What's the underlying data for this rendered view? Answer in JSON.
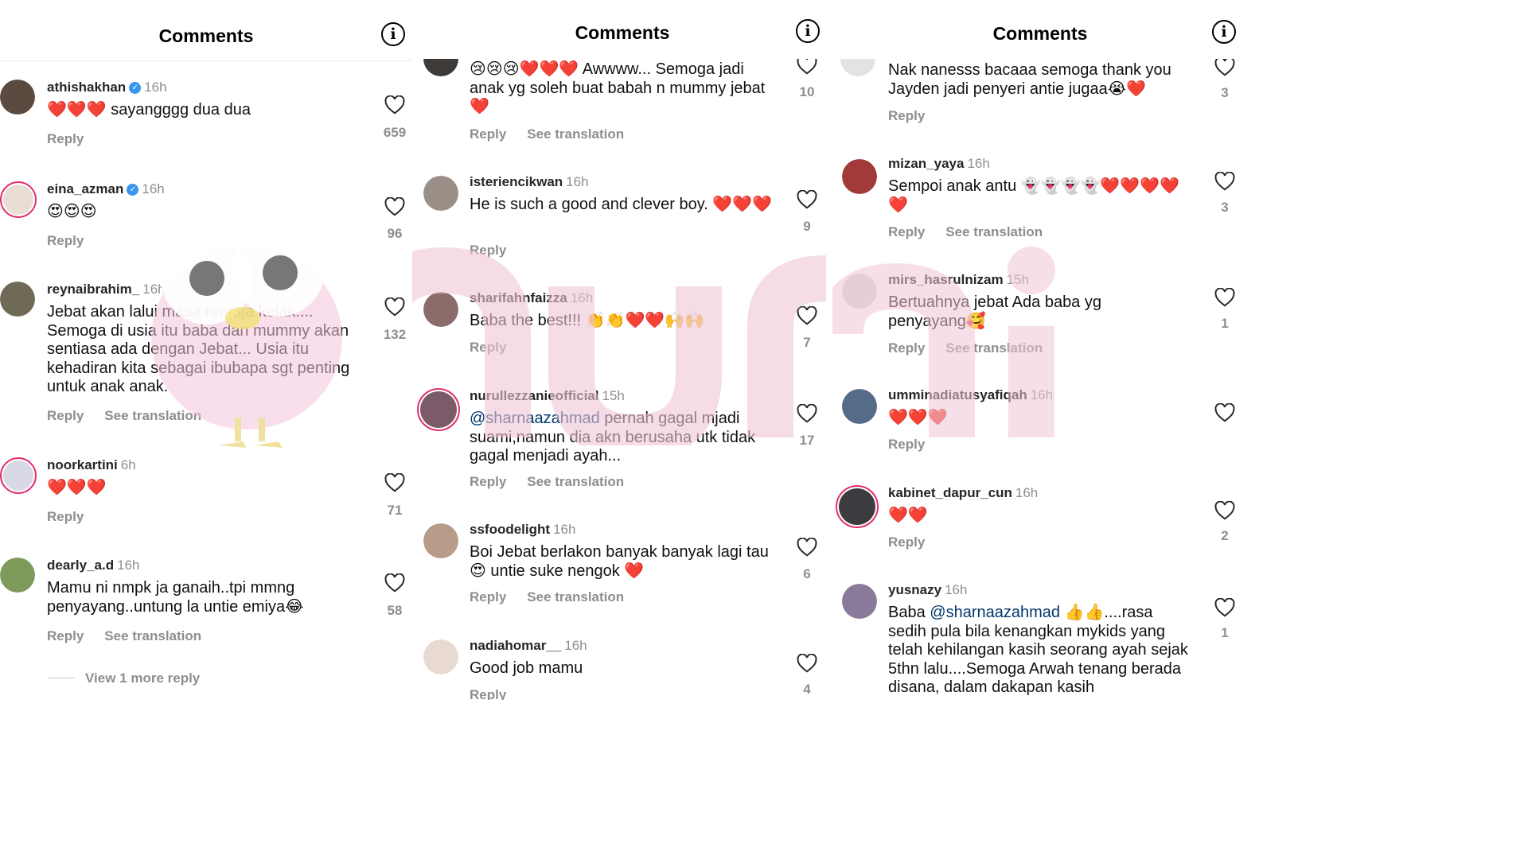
{
  "panels": [
    {
      "title": "Comments",
      "comments": [
        {
          "user": "athishakhan",
          "verified": true,
          "time": "16h",
          "text": "❤️❤️❤️ sayangggg dua dua",
          "actions": [
            "Reply"
          ],
          "likes": "659"
        },
        {
          "user": "eina_azman",
          "verified": true,
          "time": "16h",
          "text": "😍😍😍",
          "actions": [
            "Reply"
          ],
          "likes": "96"
        },
        {
          "user": "reynaibrahim_",
          "verified": false,
          "time": "16h",
          "text": "Jebat akan lalui masa remaja kelak.... Semoga di usia itu baba dan mummy akan sentiasa ada dengan Jebat... Usia itu kehadiran kita sebagai ibubapa sgt penting untuk anak anak.",
          "actions": [
            "Reply",
            "See translation"
          ],
          "likes": "132"
        },
        {
          "user": "noorkartini",
          "verified": false,
          "time": "6h",
          "text": "❤️❤️❤️",
          "actions": [
            "Reply"
          ],
          "likes": "71"
        },
        {
          "user": "dearly_a.d",
          "verified": false,
          "time": "16h",
          "text": "Mamu ni nmpk ja ganaih..tpi mmng penyayang..untung la untie emiya😂",
          "actions": [
            "Reply",
            "See translation"
          ],
          "likes": "58"
        }
      ],
      "more_replies": "View 1 more reply"
    },
    {
      "title": "Comments",
      "comments": [
        {
          "user": "",
          "verified": false,
          "time": "",
          "text": "😢😢😢❤️❤️❤️ Awwww... Semoga jadi anak yg soleh buat babah n mummy jebat❤️",
          "actions": [
            "Reply",
            "See translation"
          ],
          "likes": "10"
        },
        {
          "user": "isteriencikwan",
          "verified": false,
          "time": "16h",
          "text": "He is such a good and clever boy. ❤️❤️❤️",
          "actions": [
            "Reply"
          ],
          "likes": "9"
        },
        {
          "user": "sharifahnfaizza",
          "verified": false,
          "time": "16h",
          "text": "Baba the best!!! 👏👏❤️❤️🙌🙌",
          "actions": [
            "Reply"
          ],
          "likes": "7"
        },
        {
          "user": "nurullezzanieofficial",
          "verified": false,
          "time": "15h",
          "mention": "@sharnaazahmad",
          "text": " pernah gagal mjadi suami,namun dia akn berusaha utk tidak gagal menjadi ayah...",
          "actions": [
            "Reply",
            "See translation"
          ],
          "likes": "17"
        },
        {
          "user": "ssfoodelight",
          "verified": false,
          "time": "16h",
          "text": "Boi Jebat berlakon banyak banyak lagi tau 😍 untie suke nengok ❤️",
          "actions": [
            "Reply",
            "See translation"
          ],
          "likes": "6"
        },
        {
          "user": "nadiahomar__",
          "verified": false,
          "time": "16h",
          "text": "Good job mamu",
          "actions": [
            "Reply"
          ],
          "likes": "4"
        }
      ]
    },
    {
      "title": "Comments",
      "comments": [
        {
          "user": "",
          "verified": false,
          "time": "",
          "text": "Nak nanesss bacaaa semoga thank you Jayden jadi penyeri antie jugaa😭❤️",
          "actions": [
            "Reply"
          ],
          "likes": "3"
        },
        {
          "user": "mizan_yaya",
          "verified": false,
          "time": "16h",
          "text": "Sempoi anak antu 👻👻👻👻❤️❤️❤️❤️❤️",
          "actions": [
            "Reply",
            "See translation"
          ],
          "likes": "3"
        },
        {
          "user": "mirs_hasrulnizam",
          "verified": false,
          "time": "15h",
          "text": "Bertuahnya jebat Ada baba yg penyayang🥰",
          "actions": [
            "Reply",
            "See translation"
          ],
          "likes": "1"
        },
        {
          "user": "umminadiatusyafiqah",
          "verified": false,
          "time": "16h",
          "text": "❤️❤️❤️",
          "actions": [
            "Reply"
          ],
          "likes": ""
        },
        {
          "user": "kabinet_dapur_cun",
          "verified": false,
          "time": "16h",
          "text": "❤️❤️",
          "actions": [
            "Reply"
          ],
          "likes": "2"
        },
        {
          "user": "yusnazy",
          "verified": false,
          "time": "16h",
          "mention": "@sharnaazahmad",
          "text_prefix": "Baba ",
          "text": " 👍👍....rasa sedih pula bila kenangkan mykids yang telah kehilangan kasih seorang ayah sejak 5thn lalu....Semoga Arwah tenang berada disana, dalam dakapan kasih",
          "actions": [],
          "likes": "1"
        }
      ]
    }
  ],
  "colors": {
    "accent": "#3897f0",
    "heart": "#e0202a",
    "mention": "#00376b",
    "muted": "#8e8e8e"
  }
}
